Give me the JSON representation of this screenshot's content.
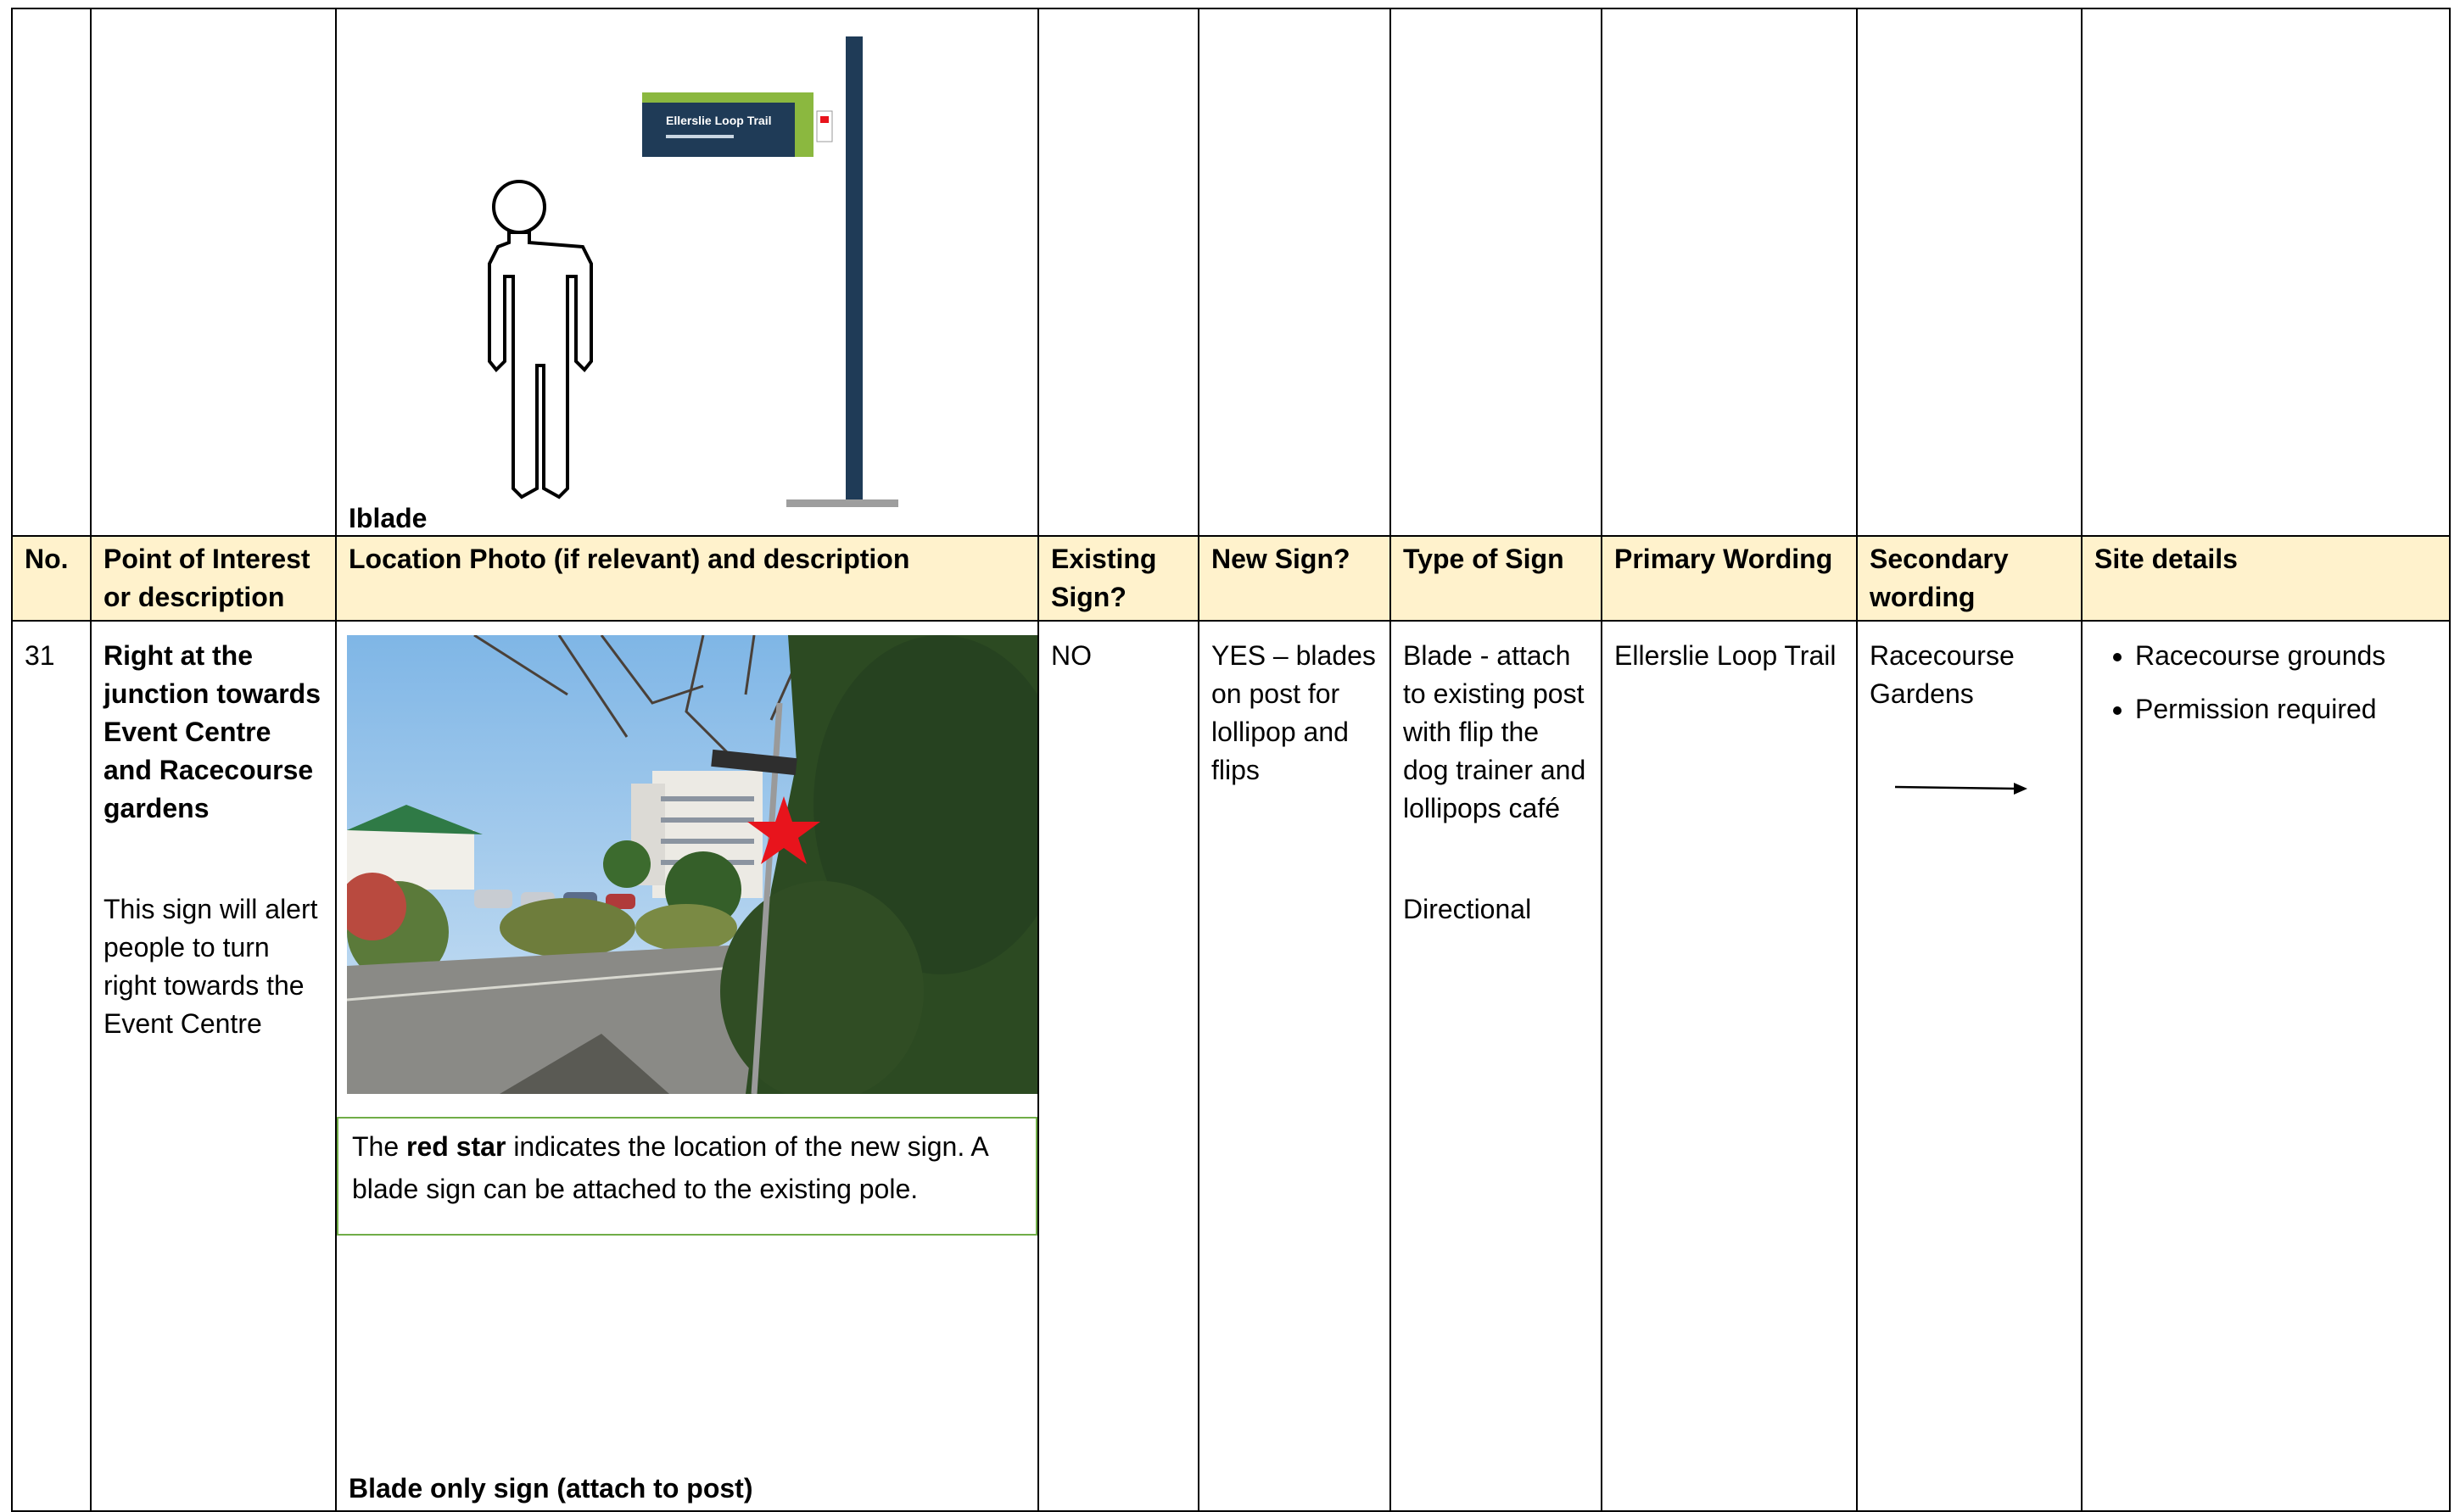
{
  "diagram": {
    "label": "Iblade",
    "panel_text": "Ellerslie Loop Trail"
  },
  "headers": {
    "no": "No.",
    "poi": "Point of Interest or description",
    "location": "Location Photo (if relevant) and description",
    "existing": "Existing Sign?",
    "new_sign": "New Sign?",
    "type": "Type of Sign",
    "primary": "Primary Wording",
    "secondary": "Secondary wording",
    "site": "Site details"
  },
  "row": {
    "no": "31",
    "poi_title": "Right at the junction towards Event Centre and Racecourse gardens",
    "poi_desc": "This sign will alert people to turn right towards the Event Centre",
    "callout": {
      "prefix": "The ",
      "bold": "red star",
      "rest": " indicates the location of the new sign. A blade sign can be attached to the existing pole."
    },
    "blade_only": "Blade only sign (attach to post)",
    "existing": "NO",
    "new_sign": "YES – blades on post for lollipop and flips",
    "type_main": "Blade -  attach to existing post with flip the dog trainer and lollipops café",
    "type_secondary": "Directional",
    "primary": "Ellerslie Loop Trail",
    "secondary": "Racecourse Gardens",
    "site_details": [
      "Racecourse grounds",
      "Permission required"
    ]
  },
  "colors": {
    "header_bg": "#fff2cc",
    "callout_border": "#70ad47",
    "sign_post": "#1f3b57",
    "star": "#e8141c"
  }
}
